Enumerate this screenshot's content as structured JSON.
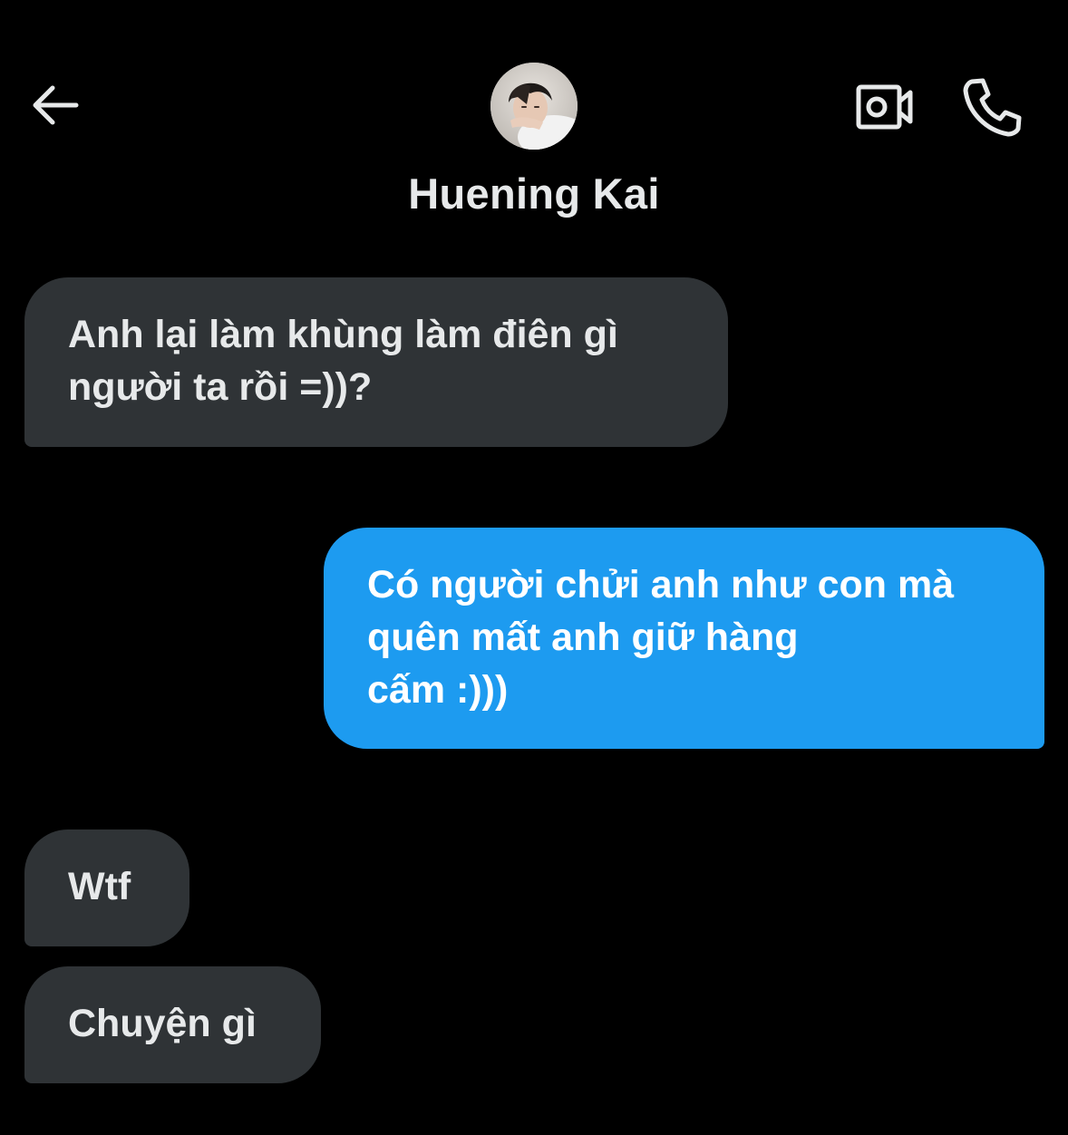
{
  "header": {
    "contact_name": "Huening Kai",
    "icons": {
      "back": "arrow-left-icon",
      "avatar": "profile-photo",
      "video": "video-camera-icon",
      "call": "phone-icon"
    }
  },
  "messages": [
    {
      "direction": "incoming",
      "lines": [
        "Anh lại làm khùng làm điên gì",
        "người ta rồi =))?"
      ]
    },
    {
      "direction": "outgoing",
      "lines": [
        "Có người chửi anh như con mà",
        "quên mất anh giữ hàng",
        "cấm :)))"
      ]
    },
    {
      "direction": "incoming",
      "lines": [
        "Wtf"
      ]
    },
    {
      "direction": "incoming",
      "lines": [
        "Chuyện gì"
      ]
    }
  ],
  "colors": {
    "background": "#000000",
    "incoming_bubble": "#2f3336",
    "outgoing_bubble": "#1d9bf0",
    "text": "#e7e9ea"
  }
}
